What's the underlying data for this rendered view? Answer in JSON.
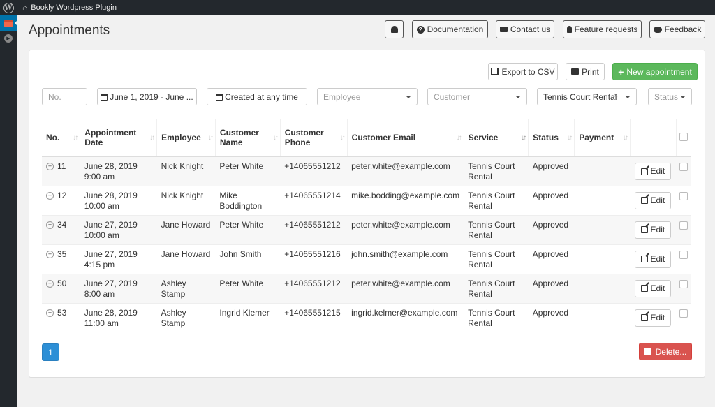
{
  "adminbar": {
    "site_title": "Bookly Wordpress Plugin",
    "wp_glyph": "W",
    "home_glyph": "⌂"
  },
  "page": {
    "title": "Appointments"
  },
  "top_buttons": {
    "documentation": "Documentation",
    "contact": "Contact us",
    "feature": "Feature requests",
    "feedback": "Feedback",
    "help_glyph": "?"
  },
  "toolbar": {
    "export": "Export to CSV",
    "print": "Print",
    "new_appointment": "New appointment",
    "new_glyph": "+"
  },
  "filters": {
    "no_placeholder": "No.",
    "date_range": "June 1, 2019 - June ...",
    "created": "Created at any time",
    "employee": "Employee",
    "customer": "Customer",
    "service": "Tennis Court Rental",
    "service_clear": "×",
    "status": "Status"
  },
  "table": {
    "headers": {
      "no": "No.",
      "date": "Appointment Date",
      "employee": "Employee",
      "customer_name": "Customer Name",
      "customer_phone": "Customer Phone",
      "customer_email": "Customer Email",
      "service": "Service",
      "status": "Status",
      "payment": "Payment"
    },
    "sort_glyph": "↓↑",
    "expand_glyph": "+",
    "edit_label": "Edit",
    "rows": [
      {
        "no": "11",
        "date": "June 28, 2019 9:00 am",
        "employee": "Nick Knight",
        "customer": "Peter White",
        "phone": "+14065551212",
        "email": "peter.white@example.com",
        "service": "Tennis Court Rental",
        "status": "Approved",
        "payment": ""
      },
      {
        "no": "12",
        "date": "June 28, 2019 10:00 am",
        "employee": "Nick Knight",
        "customer": "Mike Boddington",
        "phone": "+14065551214",
        "email": "mike.bodding@example.com",
        "service": "Tennis Court Rental",
        "status": "Approved",
        "payment": ""
      },
      {
        "no": "34",
        "date": "June 27, 2019 10:00 am",
        "employee": "Jane Howard",
        "customer": "Peter White",
        "phone": "+14065551212",
        "email": "peter.white@example.com",
        "service": "Tennis Court Rental",
        "status": "Approved",
        "payment": ""
      },
      {
        "no": "35",
        "date": "June 27, 2019 4:15 pm",
        "employee": "Jane Howard",
        "customer": "John Smith",
        "phone": "+14065551216",
        "email": "john.smith@example.com",
        "service": "Tennis Court Rental",
        "status": "Approved",
        "payment": ""
      },
      {
        "no": "50",
        "date": "June 27, 2019 8:00 am",
        "employee": "Ashley Stamp",
        "customer": "Peter White",
        "phone": "+14065551212",
        "email": "peter.white@example.com",
        "service": "Tennis Court Rental",
        "status": "Approved",
        "payment": ""
      },
      {
        "no": "53",
        "date": "June 28, 2019 11:00 am",
        "employee": "Ashley Stamp",
        "customer": "Ingrid Klemer",
        "phone": "+14065551215",
        "email": "ingrid.kelmer@example.com",
        "service": "Tennis Court Rental",
        "status": "Approved",
        "payment": ""
      }
    ]
  },
  "pagination": {
    "current_page": "1"
  },
  "footer": {
    "delete": "Delete..."
  },
  "colors": {
    "accent_green": "#5cb85c",
    "danger_red": "#d9534f",
    "primary_blue": "#2d8fd6",
    "adminbar": "#23282d"
  }
}
